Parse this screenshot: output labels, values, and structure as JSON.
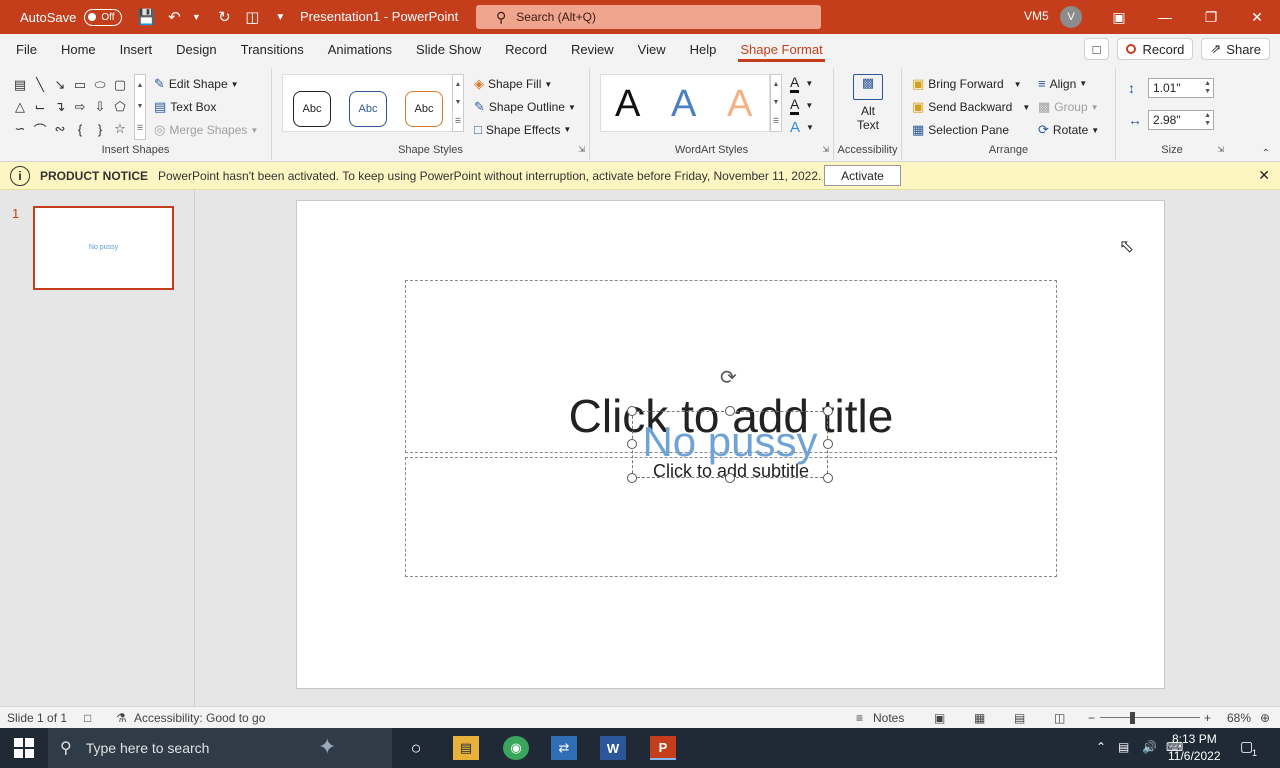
{
  "titlebar": {
    "autosave_label": "AutoSave",
    "autosave_state": "Off",
    "doc_title": "Presentation1 - PowerPoint",
    "search_placeholder": "Search (Alt+Q)",
    "user_initials": "VM5",
    "avatar_letter": "V"
  },
  "menu": {
    "tabs": [
      "File",
      "Home",
      "Insert",
      "Design",
      "Transitions",
      "Animations",
      "Slide Show",
      "Record",
      "Review",
      "View",
      "Help",
      "Shape Format"
    ],
    "active_tab": "Shape Format",
    "record_label": "Record",
    "share_label": "Share"
  },
  "ribbon": {
    "insert_shapes": {
      "label": "Insert Shapes",
      "edit_shape": "Edit Shape",
      "text_box": "Text Box",
      "merge_shapes": "Merge Shapes"
    },
    "shape_styles": {
      "label": "Shape Styles",
      "sample": "Abc",
      "shape_fill": "Shape Fill",
      "shape_outline": "Shape Outline",
      "shape_effects": "Shape Effects"
    },
    "wordart_styles": {
      "label": "WordArt Styles",
      "sample": "A"
    },
    "accessibility": {
      "label": "Accessibility",
      "alt_text_1": "Alt",
      "alt_text_2": "Text"
    },
    "arrange": {
      "label": "Arrange",
      "bring_forward": "Bring Forward",
      "send_backward": "Send Backward",
      "selection_pane": "Selection Pane",
      "align": "Align",
      "group": "Group",
      "rotate": "Rotate"
    },
    "size": {
      "label": "Size",
      "height": "1.01\"",
      "width": "2.98\""
    }
  },
  "notice": {
    "heading": "PRODUCT NOTICE",
    "message": "PowerPoint hasn't been activated. To keep using PowerPoint without interruption, activate before Friday, November 11, 2022.",
    "button": "Activate"
  },
  "thumbnails": {
    "number": "1",
    "text": "No pussy"
  },
  "slide": {
    "title_placeholder": "Click to add title",
    "subtitle_placeholder": "Click to add subtitle",
    "wordart_text": "No pussy"
  },
  "status": {
    "slide_info": "Slide 1 of 1",
    "accessibility": "Accessibility: Good to go",
    "notes": "Notes",
    "zoom": "68%"
  },
  "taskbar": {
    "search_placeholder": "Type here to search",
    "time": "8:13 PM",
    "date": "11/6/2022",
    "notif_count": "1"
  },
  "colors": {
    "brand": "#c43e1c",
    "notice_bg": "#fdf6c3",
    "wordart_blue": "#6fa3d6"
  }
}
